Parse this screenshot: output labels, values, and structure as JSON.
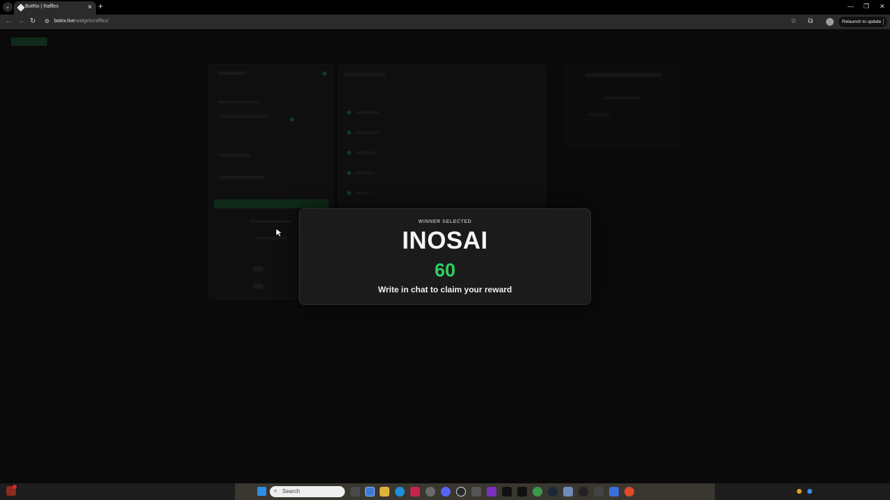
{
  "browser": {
    "tab_title": "BotRix | Raffles",
    "url_host": "botrix.live",
    "url_path": "/widgets/raffles/",
    "relaunch_label": "Relaunch to update"
  },
  "modal": {
    "label": "WINNER SELECTED",
    "winner_name": "INOSAI",
    "value": "60",
    "message": "Write in chat to claim your reward",
    "value_color": "#2ecf62"
  },
  "taskbar": {
    "search_placeholder": "Search"
  },
  "colors": {
    "accent": "#2ecf62",
    "page_bg": "#0a0a0a",
    "modal_bg": "#1b1b1b"
  }
}
